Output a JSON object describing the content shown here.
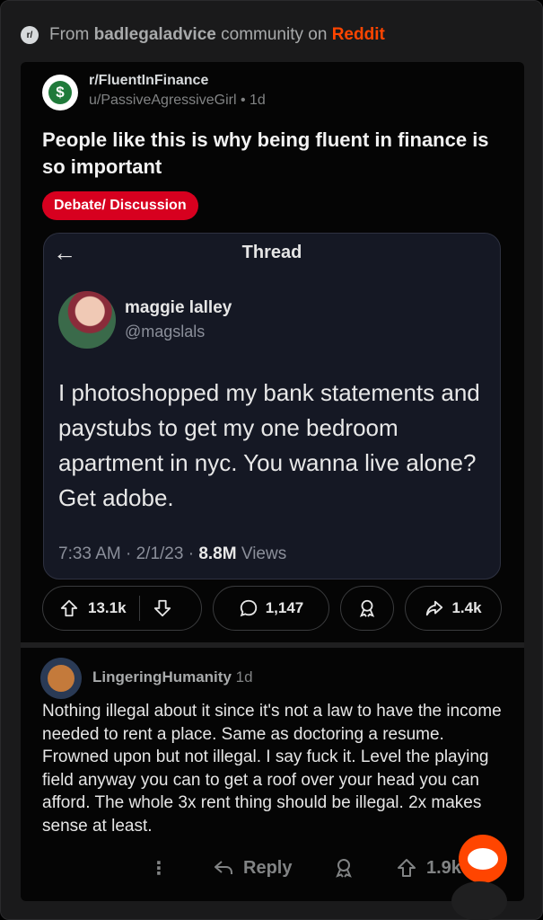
{
  "header": {
    "prefix": "From",
    "community": "badlegaladvice",
    "middle": "community on",
    "brand": "Reddit",
    "badge": "r/"
  },
  "post": {
    "subreddit": "r/FluentInFinance",
    "author": "u/PassiveAgressiveGirl",
    "age": "1d",
    "title": "People like this is why being fluent in finance is so important",
    "flair": "Debate/ Discussion",
    "icon_glyph": "$"
  },
  "embed": {
    "back": "←",
    "title": "Thread",
    "name": "maggie lalley",
    "handle": "@magslals",
    "text": "I photoshopped my bank statements and paystubs to get my one bedroom apartment in nyc. You wanna live alone? Get adobe.",
    "time": "7:33 AM",
    "date": "2/1/23",
    "views": "8.8M",
    "views_label": "Views"
  },
  "actions": {
    "upvotes": "13.1k",
    "comments": "1,147",
    "shares": "1.4k"
  },
  "comment": {
    "author": "LingeringHumanity",
    "age": "1d",
    "body": "Nothing illegal about it since it's not a law to have the income needed to rent a place. Same as doctoring a resume. Frowned upon but not illegal. I say fuck it. Level the playing field anyway you can to get a roof over your head you can afford. The whole 3x rent thing should be illegal.  2x makes sense at least.",
    "more": "⋮",
    "reply": "Reply",
    "votes": "1.9k"
  },
  "colors": {
    "brand": "#ff4500",
    "flair": "#d7001f",
    "embed_bg": "#151824"
  },
  "icons": [
    "reddit-badge-icon",
    "subreddit-icon",
    "back-arrow-icon",
    "upvote-icon",
    "downvote-icon",
    "comment-icon",
    "award-icon",
    "share-icon",
    "reply-icon",
    "more-icon",
    "snoo-icon"
  ]
}
